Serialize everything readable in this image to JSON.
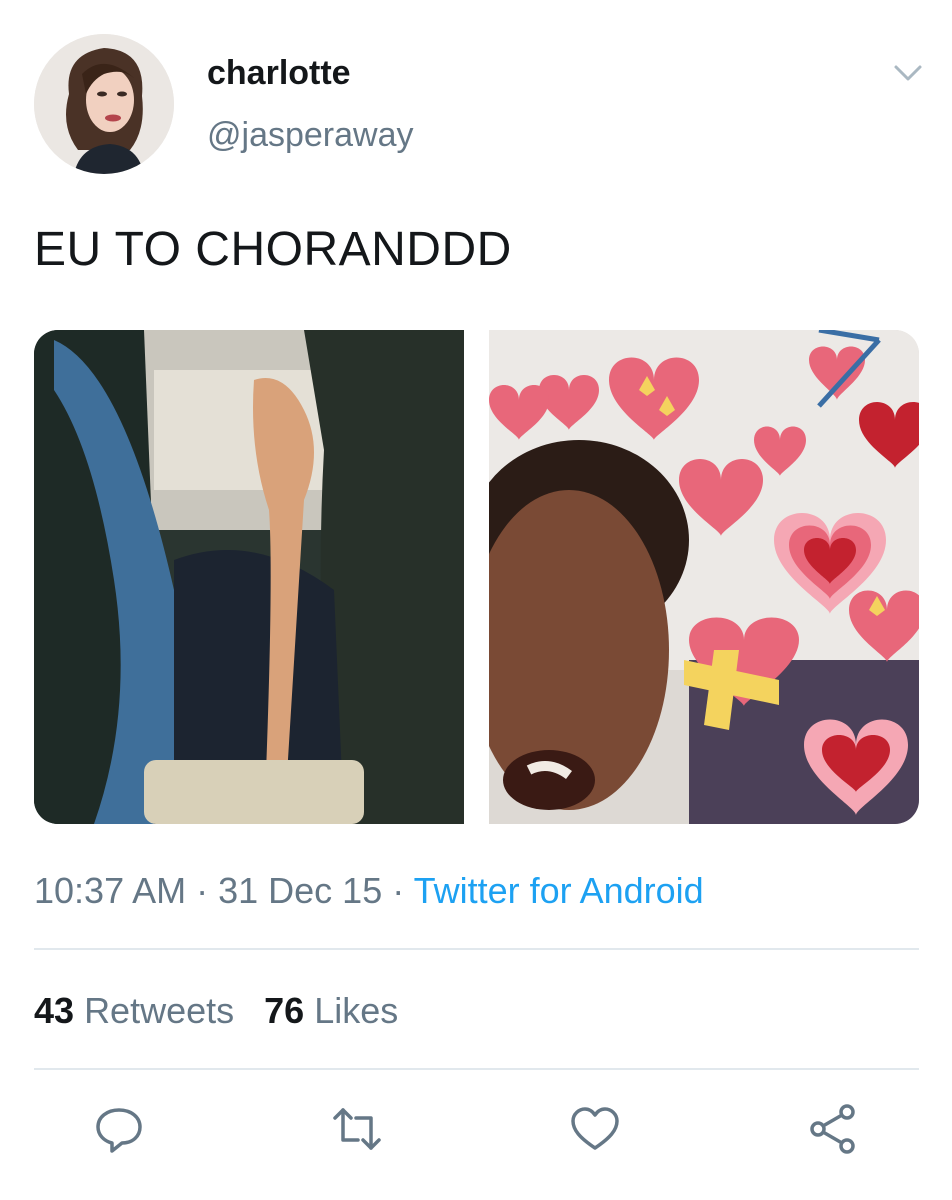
{
  "author": {
    "display_name": "charlotte",
    "handle": "@jasperaway"
  },
  "tweet": {
    "text": "EU TO CHORANDDD"
  },
  "meta": {
    "time": "10:37 AM",
    "separator1": " · ",
    "date": "31 Dec 15",
    "separator2": " · ",
    "source": "Twitter for Android"
  },
  "stats": {
    "retweets_count": "43",
    "retweets_label": "Retweets",
    "likes_count": "76",
    "likes_label": "Likes"
  },
  "icons": {
    "menu": "chevron-down-icon",
    "reply": "reply-icon",
    "retweet": "retweet-icon",
    "like": "heart-icon",
    "share": "share-icon"
  },
  "colors": {
    "link": "#1da1f2",
    "secondary_text": "#657786",
    "divider": "#e1e8ed"
  }
}
